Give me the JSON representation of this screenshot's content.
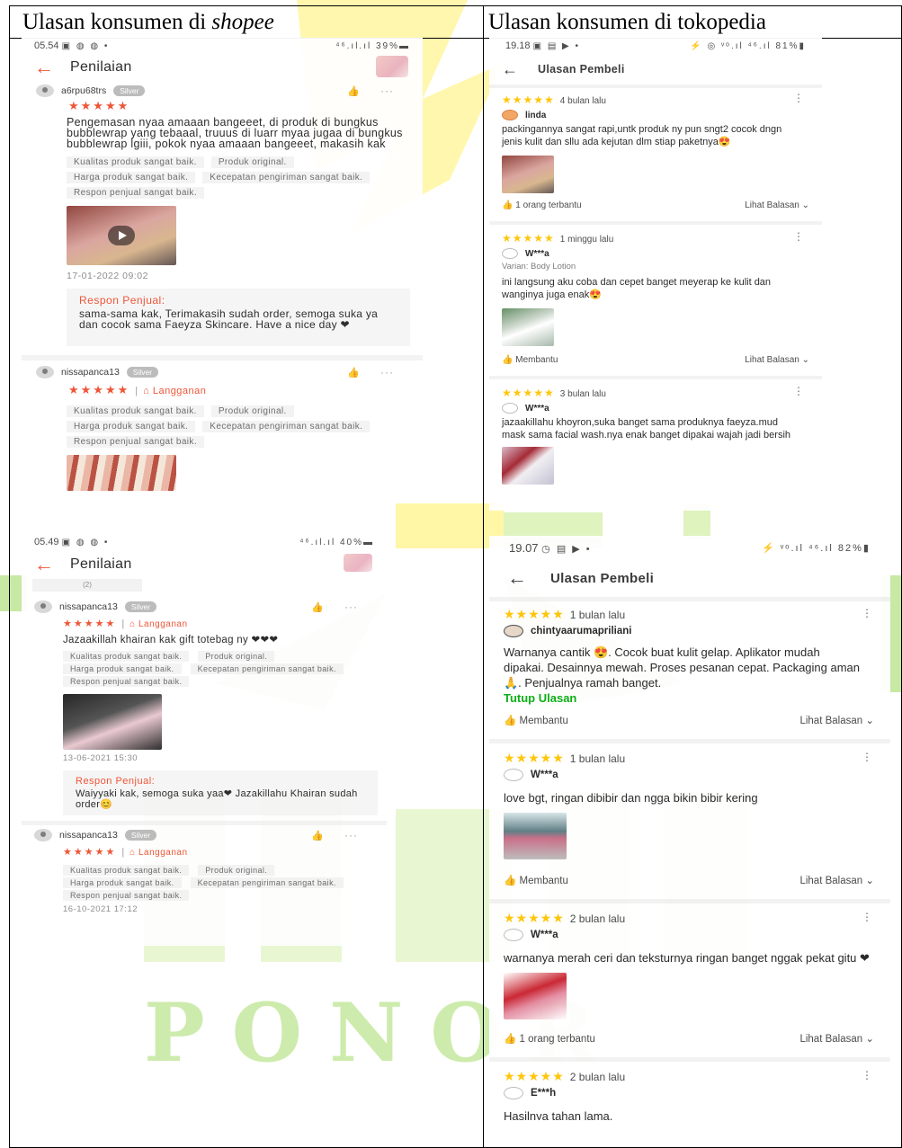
{
  "headers": {
    "left": {
      "text": "Ulasan konsumen di ",
      "italic": "shopee"
    },
    "right": "Ulasan konsumen di tokopedia"
  },
  "watermark": "PONOR",
  "shopee1": {
    "status": {
      "time": "05.54",
      "icons": "▣ ◍ ◍ •",
      "right": "⁴⁶.ıl.ıl 39%▬"
    },
    "title": "Penilaian",
    "r1": {
      "user": "a6rpu68trs",
      "badge": "Silver",
      "stars": "★★★★★",
      "text": "Pengemasan nyaa amaaan bangeeet, di produk di bungkus bubblewrap yang tebaaal, truuus di luarr myaa jugaa di bungkus bubblewrap lgiii, pokok nyaa amaaan bangeeet, makasih kak",
      "tags": [
        "Kualitas produk sangat baik.",
        "Produk original.",
        "Harga produk sangat baik.",
        "Kecepatan pengiriman sangat baik.",
        "Respon penjual sangat baik."
      ],
      "date": "17-01-2022 09:02",
      "resp_title": "Respon Penjual:",
      "resp_text": "sama-sama kak, Terimakasih sudah order, semoga suka ya dan cocok sama Faeyza Skincare. Have a nice day ❤"
    },
    "r2": {
      "user": "nissapanca13",
      "badge": "Silver",
      "stars": "★★★★★",
      "sep": "|",
      "lang": "⌂ Langganan",
      "tags": [
        "Kualitas produk sangat baik.",
        "Produk original.",
        "Harga produk sangat baik.",
        "Kecepatan pengiriman sangat baik.",
        "Respon penjual sangat baik."
      ]
    }
  },
  "shopee2": {
    "status": {
      "time": "05.49",
      "icons": "▣ ◍ ◍ •",
      "right": "⁴⁶.ıl.ıl 40%▬"
    },
    "title": "Penilaian",
    "count": "(2)",
    "r1": {
      "user": "nissapanca13",
      "badge": "Silver",
      "stars": "★★★★★",
      "sep": "|",
      "lang": "⌂ Langganan",
      "text": "Jazaakillah khairan kak gift totebag ny ❤❤❤",
      "tags": [
        "Kualitas produk sangat baik.",
        "Produk original.",
        "Harga produk sangat baik.",
        "Kecepatan pengiriman sangat baik.",
        "Respon penjual sangat baik."
      ],
      "date": "13-06-2021 15:30",
      "resp_title": "Respon Penjual:",
      "resp_text": "Waiyyaki kak, semoga suka yaa❤ Jazakillahu Khairan sudah order😊"
    },
    "r2": {
      "user": "nissapanca13",
      "badge": "Silver",
      "stars": "★★★★★",
      "sep": "|",
      "lang": "⌂ Langganan",
      "tags": [
        "Kualitas produk sangat baik.",
        "Produk original.",
        "Harga produk sangat baik.",
        "Kecepatan pengiriman sangat baik.",
        "Respon penjual sangat baik."
      ],
      "date": "16-10-2021 17:12"
    }
  },
  "toped1": {
    "status": {
      "time": "19.18",
      "icons": "▣ ▤ ▶ •",
      "right": "⚡ ◎ ᵛᵒ.ıl ⁴⁶.ıl 81%▮"
    },
    "title": "Ulasan Pembeli",
    "r1": {
      "stars": "★★★★★",
      "time": "4 bulan lalu",
      "user": "linda",
      "text": "packingannya sangat rapi,untk produk ny pun sngt2 cocok dngn jenis kulit dan sllu ada kejutan dlm stiap paketnya😍",
      "helpful": "1 orang terbantu",
      "balasan": "Lihat Balasan"
    },
    "r2": {
      "stars": "★★★★★",
      "time": "1 minggu lalu",
      "user": "W***a",
      "varian": "Varian: Body Lotion",
      "text": "ini langsung aku coba dan cepet banget meyerap ke kulit dan wanginya juga enak😍",
      "helpful": "Membantu",
      "balasan": "Lihat Balasan"
    },
    "r3": {
      "stars": "★★★★★",
      "time": "3 bulan lalu",
      "user": "W***a",
      "text": "jazaakillahu khoyron,suka banget sama produknya faeyza.mud mask sama facial wash.nya enak banget dipakai wajah jadi bersih"
    }
  },
  "toped2": {
    "status": {
      "time": "19.07",
      "icons": "◷ ▤ ▶ •",
      "right": "⚡ ᵛᵒ.ıl ⁴⁶.ıl 82%▮"
    },
    "title": "Ulasan Pembeli",
    "r1": {
      "stars": "★★★★★",
      "time": "1 bulan lalu",
      "user": "chintyaarumapriliani",
      "text": "Warnanya cantik 😍. Cocok buat kulit gelap. Aplikator mudah dipakai. Desainnya mewah. Proses pesanan cepat. Packaging aman 🙏. Penjualnya ramah banget.",
      "tutup": "Tutup Ulasan",
      "helpful": "Membantu",
      "balasan": "Lihat Balasan"
    },
    "r2": {
      "stars": "★★★★★",
      "time": "1 bulan lalu",
      "user": "W***a",
      "text": "love bgt, ringan dibibir dan ngga bikin bibir kering",
      "helpful": "Membantu",
      "balasan": "Lihat Balasan"
    },
    "r3": {
      "stars": "★★★★★",
      "time": "2 bulan lalu",
      "user": "W***a",
      "text": "warnanya merah ceri dan teksturnya ringan banget nggak pekat gitu ❤",
      "helpful": "1 orang terbantu",
      "balasan": "Lihat Balasan"
    },
    "r4": {
      "stars": "★★★★★",
      "time": "2 bulan lalu",
      "user": "E***h",
      "text": "Hasilnya tahan lama."
    }
  },
  "colors": {
    "shopee": "#ee4d2d",
    "tokopedia_star": "#ffc400",
    "tokopedia_green": "#03ac0e",
    "watermark_yellow": "#fff16b",
    "watermark_green": "#8fd44a"
  }
}
